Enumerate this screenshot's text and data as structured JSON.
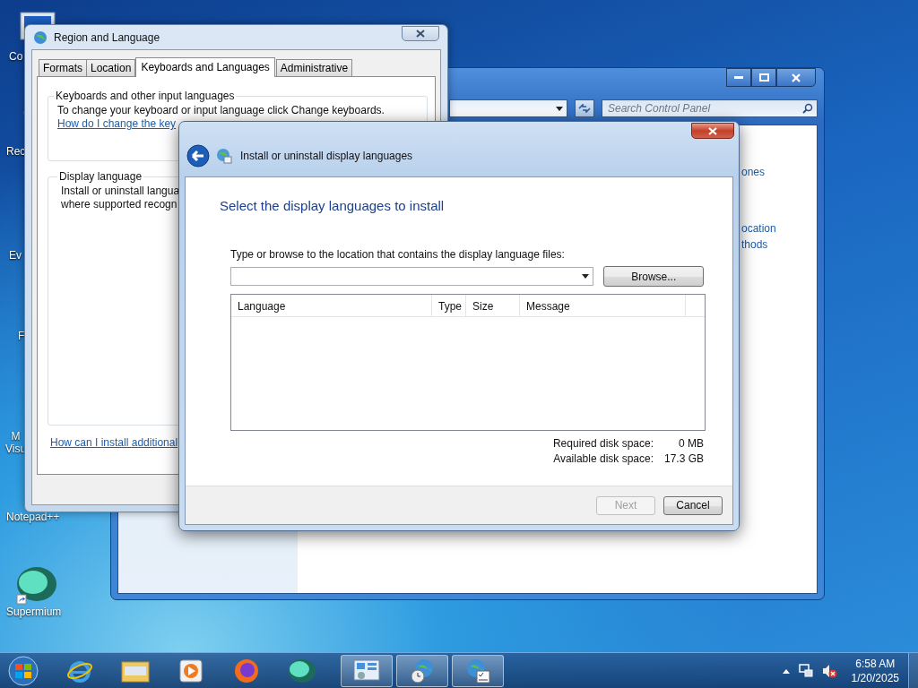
{
  "desktop_icons": [
    {
      "label": "Co",
      "kind": "computer"
    },
    {
      "label": "Rec",
      "kind": "bin"
    },
    {
      "label": "Ev",
      "kind": "shortcut"
    },
    {
      "label": "F",
      "kind": "shortcut"
    },
    {
      "label": "M\nVisu",
      "kind": "shortcut"
    },
    {
      "label": "Notepad++",
      "kind": "shortcut"
    },
    {
      "label": "Supermium",
      "kind": "orb"
    }
  ],
  "control_panel": {
    "search": {
      "placeholder": "Search Control Panel"
    },
    "links": [
      "ones",
      "ocation",
      "thods"
    ]
  },
  "region_window": {
    "title": "Region and Language",
    "tabs": [
      {
        "label": "Formats",
        "selected": false
      },
      {
        "label": "Location",
        "selected": false
      },
      {
        "label": "Keyboards and Languages",
        "selected": true
      },
      {
        "label": "Administrative",
        "selected": false
      }
    ],
    "keyboards_group": {
      "title": "Keyboards and other input languages",
      "text": "To change your keyboard or input language click Change keyboards.",
      "link": "How do I change the key"
    },
    "display_group": {
      "title": "Display language",
      "lines": [
        "Install or uninstall langua",
        "where supported recogn"
      ]
    },
    "link": "How can I install additional"
  },
  "dialog": {
    "title": "Install or uninstall display languages",
    "heading": "Select the display languages to install",
    "location_label": "Type or browse to the location that contains the display language files:",
    "browse_button": "Browse...",
    "list": {
      "columns": [
        "Language",
        "Type",
        "Size",
        "Message"
      ]
    },
    "disk": [
      {
        "label": "Required disk space:",
        "value": "0 MB"
      },
      {
        "label": "Available disk space:",
        "value": "17.3 GB"
      }
    ],
    "buttons": [
      {
        "label": "Next",
        "disabled": true
      },
      {
        "label": "Cancel",
        "disabled": false
      }
    ]
  },
  "taskbar": {
    "clock": {
      "time": "6:58 AM",
      "date": "1/20/2025"
    }
  }
}
